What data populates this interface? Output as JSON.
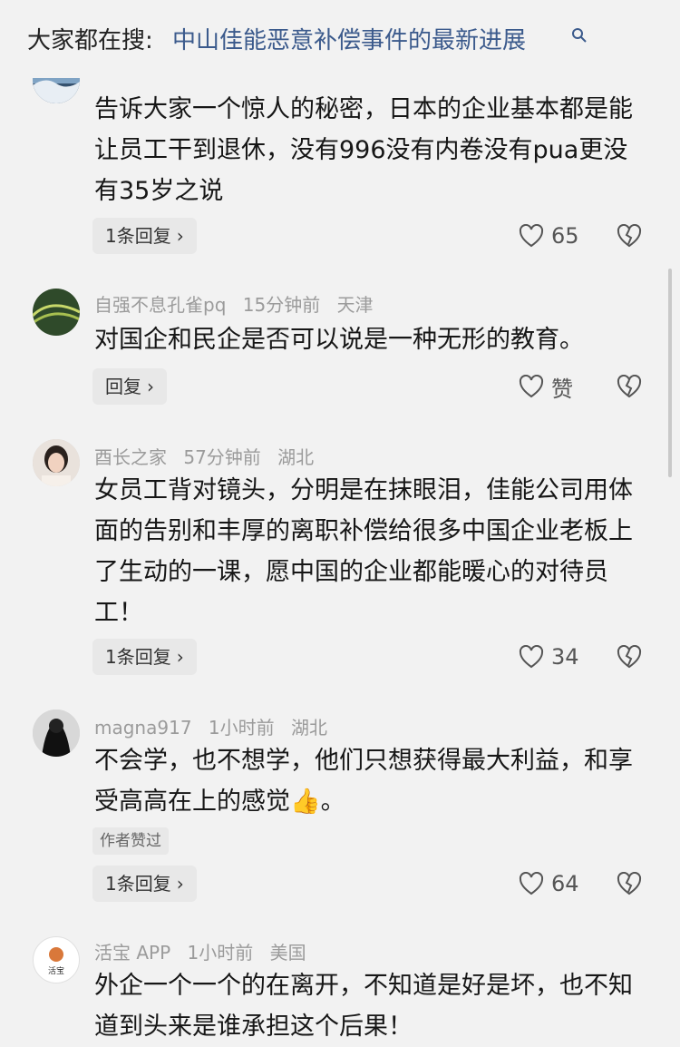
{
  "search": {
    "prefix": "大家都在搜:",
    "query": "中山佳能恶意补偿事件的最新进展"
  },
  "comments": [
    {
      "user": "",
      "time": "",
      "location": "",
      "text": "告诉大家一个惊人的秘密，日本的企业基本都是能让员工干到退休，没有996没有内卷没有pua更没有35岁之说",
      "reply_label": "1条回复",
      "likes": "65"
    },
    {
      "user": "自强不息孔雀pq",
      "time": "15分钟前",
      "location": "天津",
      "text": "对国企和民企是否可以说是一种无形的教育。",
      "reply_label": "回复",
      "likes": "赞"
    },
    {
      "user": "酉长之家",
      "time": "57分钟前",
      "location": "湖北",
      "text": "女员工背对镜头，分明是在抹眼泪，佳能公司用体面的告别和丰厚的离职补偿给很多中国企业老板上了生动的一课，愿中国的企业都能暖心的对待员工！",
      "reply_label": "1条回复",
      "likes": "34"
    },
    {
      "user": "magna917",
      "time": "1小时前",
      "location": "湖北",
      "text": "不会学，也不想学，他们只想获得最大利益，和享受高高在上的感觉👍。",
      "badge": "作者赞过",
      "reply_label": "1条回复",
      "likes": "64"
    },
    {
      "user": "活宝 APP",
      "time": "1小时前",
      "location": "美国",
      "avatar_text": "活宝",
      "text": "外企一个一个的在离开，不知道是好是坏，也不知道到头来是谁承担这个后果！"
    }
  ]
}
